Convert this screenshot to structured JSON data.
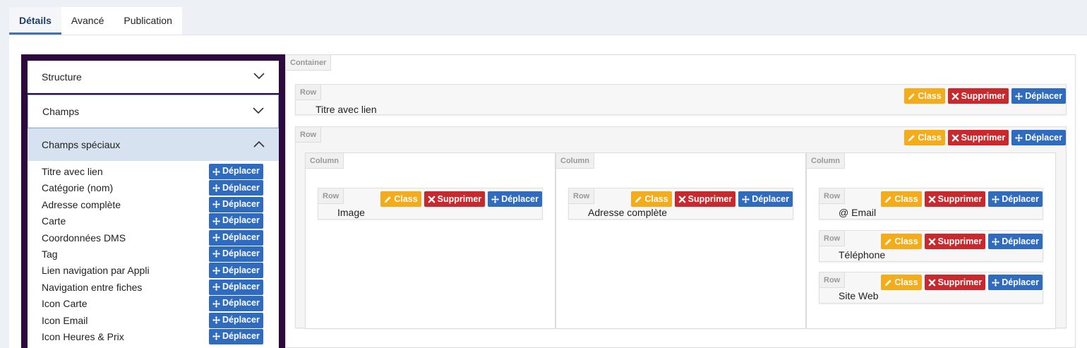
{
  "tabs": [
    {
      "label": "Détails",
      "active": true
    },
    {
      "label": "Avancé",
      "active": false
    },
    {
      "label": "Publication",
      "active": false
    }
  ],
  "sidebar": {
    "sections": [
      {
        "label": "Structure",
        "open": false
      },
      {
        "label": "Champs",
        "open": false
      },
      {
        "label": "Champs spéciaux",
        "open": true
      }
    ],
    "special_fields": [
      "Titre avec lien",
      "Catégorie (nom)",
      "Adresse complète",
      "Carte",
      "Coordonnées DMS",
      "Tag",
      "Lien navigation par Appli",
      "Navigation entre fiches",
      "Icon Carte",
      "Icon Email",
      "Icon Heures & Prix"
    ],
    "move_label": "Déplacer"
  },
  "builder": {
    "container_label": "Container",
    "row_label": "Row",
    "column_label": "Column",
    "buttons": {
      "class": "Class",
      "delete": "Supprimer",
      "move": "Déplacer"
    },
    "top_row_field": "Titre avec lien",
    "columns": [
      {
        "fields": [
          "Image"
        ]
      },
      {
        "fields": [
          "Adresse complète"
        ]
      },
      {
        "fields": [
          "@ Email",
          "Téléphone",
          "Site Web"
        ]
      }
    ]
  },
  "colors": {
    "class_button": "#f4ac1b",
    "delete_button": "#c9282d",
    "move_button": "#2f6bbf",
    "sidebar_bg": "#2d0a3e"
  },
  "icons": {
    "class": "pencil-icon",
    "delete": "x-icon",
    "move": "arrows-move-icon",
    "accordion": "chevron-icon"
  }
}
